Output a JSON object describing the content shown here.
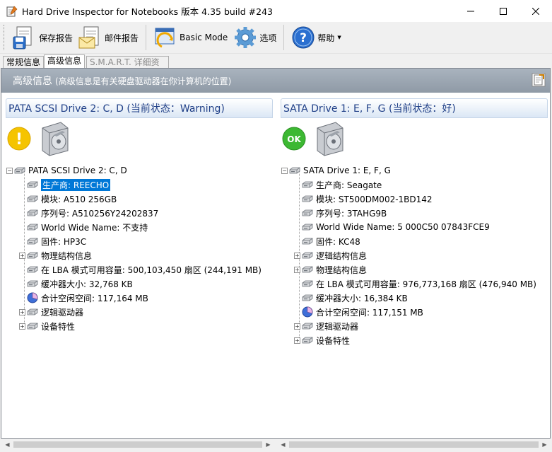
{
  "window": {
    "title": "Hard Drive Inspector for Notebooks 版本 4.35 build #243"
  },
  "toolbar": {
    "save_report": "保存报告",
    "mail_report": "邮件报告",
    "basic_mode": "Basic Mode",
    "options": "选项",
    "help": "帮助"
  },
  "tabs": [
    {
      "label": "常规信息"
    },
    {
      "label": "高级信息"
    },
    {
      "label": "S.M.A.R.T. 详细资料"
    }
  ],
  "banner": {
    "title": "高级信息",
    "subtitle": "(高级信息是有关硬盘驱动器在你计算机的位置)"
  },
  "left_panel": {
    "header": "PATA SCSI Drive 2: C, D (当前状态：Warning)",
    "status": "warning",
    "status_symbol": "!",
    "root": "PATA SCSI Drive 2: C, D",
    "items": [
      {
        "text": "生产商: REECHO",
        "selected": true,
        "expand": false,
        "icon": "drive-icon"
      },
      {
        "text": "模块: A510 256GB",
        "selected": false,
        "expand": false,
        "icon": "drive-icon"
      },
      {
        "text": "序列号: A510256Y24202837",
        "selected": false,
        "expand": false,
        "icon": "drive-icon"
      },
      {
        "text": "World Wide Name: 不支持",
        "selected": false,
        "expand": false,
        "icon": "drive-icon"
      },
      {
        "text": "固件: HP3C",
        "selected": false,
        "expand": false,
        "icon": "drive-icon"
      },
      {
        "text": "物理结构信息",
        "selected": false,
        "expand": true,
        "icon": "drive-icon"
      },
      {
        "text": "在 LBA 模式可用容量: 500,103,450 扇区 (244,191 MB)",
        "selected": false,
        "expand": false,
        "icon": "drive-icon"
      },
      {
        "text": "缓冲器大小: 32,768 KB",
        "selected": false,
        "expand": false,
        "icon": "drive-icon"
      },
      {
        "text": "合计空闲空间: 117,164 MB",
        "selected": false,
        "expand": false,
        "icon": "pie-icon"
      },
      {
        "text": "逻辑驱动器",
        "selected": false,
        "expand": true,
        "icon": "drive-icon"
      },
      {
        "text": "设备特性",
        "selected": false,
        "expand": true,
        "icon": "drive-icon"
      }
    ]
  },
  "right_panel": {
    "header": "SATA Drive 1: E, F, G (当前状态：好)",
    "status": "ok",
    "status_symbol": "OK",
    "root": "SATA Drive 1: E, F, G",
    "items": [
      {
        "text": "生产商: Seagate",
        "selected": false,
        "expand": false,
        "icon": "drive-icon"
      },
      {
        "text": "模块: ST500DM002-1BD142",
        "selected": false,
        "expand": false,
        "icon": "drive-icon"
      },
      {
        "text": "序列号: 3TAHG9B",
        "selected": false,
        "expand": false,
        "icon": "drive-icon"
      },
      {
        "text": "World Wide Name: 5 000C50 07843FCE9",
        "selected": false,
        "expand": false,
        "icon": "drive-icon"
      },
      {
        "text": "固件: KC48",
        "selected": false,
        "expand": false,
        "icon": "drive-icon"
      },
      {
        "text": "逻辑结构信息",
        "selected": false,
        "expand": true,
        "icon": "drive-icon"
      },
      {
        "text": "物理结构信息",
        "selected": false,
        "expand": true,
        "icon": "drive-icon"
      },
      {
        "text": "在 LBA 模式可用容量: 976,773,168 扇区 (476,940 MB)",
        "selected": false,
        "expand": false,
        "icon": "drive-icon"
      },
      {
        "text": "缓冲器大小: 16,384 KB",
        "selected": false,
        "expand": false,
        "icon": "drive-icon"
      },
      {
        "text": "合计空闲空间: 117,151 MB",
        "selected": false,
        "expand": false,
        "icon": "pie-icon"
      },
      {
        "text": "逻辑驱动器",
        "selected": false,
        "expand": true,
        "icon": "drive-icon"
      },
      {
        "text": "设备特性",
        "selected": false,
        "expand": true,
        "icon": "drive-icon"
      }
    ]
  },
  "colors": {
    "warning": "#f5c400",
    "ok": "#3cb832",
    "selection": "#0078d7",
    "panel_header_text": "#1f3f87"
  }
}
